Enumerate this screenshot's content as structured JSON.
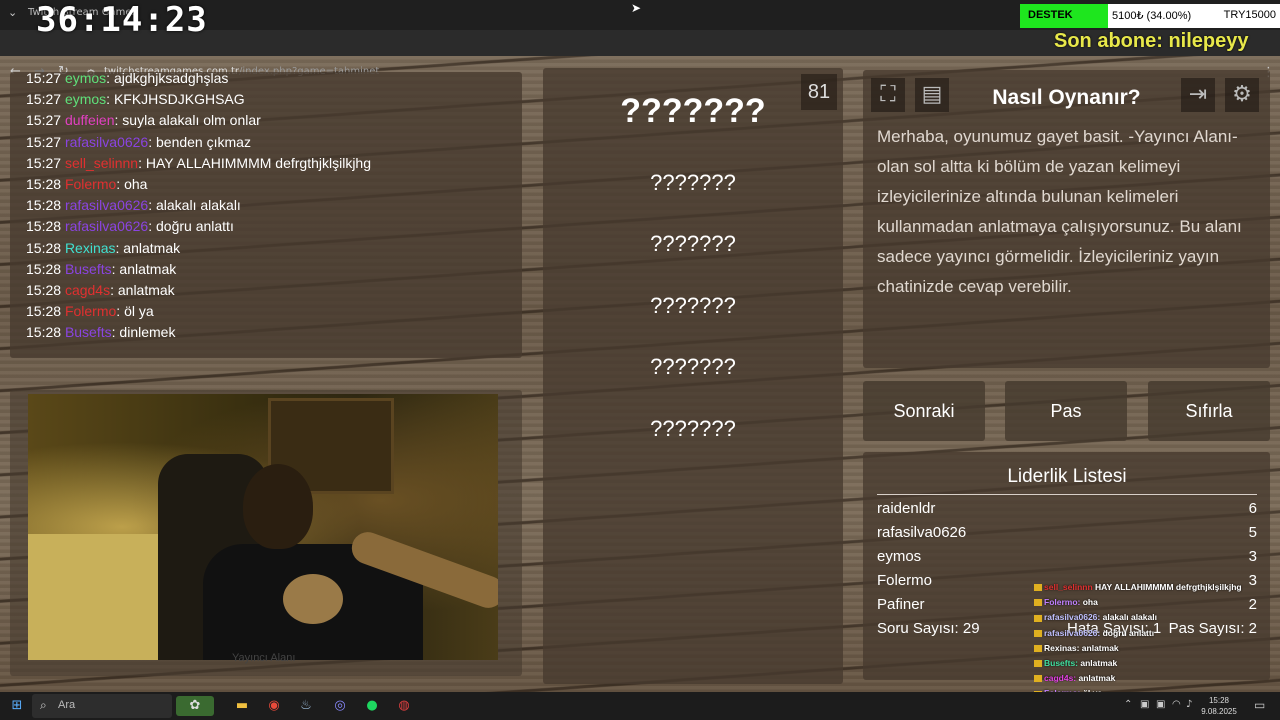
{
  "browser": {
    "tab_title": "Twitch Stream Games",
    "url_host": "twitchstreamgames.com.tr",
    "url_path": "/index.php?game=tahminet"
  },
  "timer": "36:14:23",
  "donation": {
    "label": "DESTEK",
    "value": "5100₺ (34.00%)",
    "goal": "TRY15000",
    "progress": 0.34,
    "bar_color": "#1ee61e"
  },
  "last_sub": "Son abone: nilepeyy",
  "chat": [
    {
      "time": "15:27",
      "user": "eymos",
      "color": "#5fe07a",
      "msg": ": ajdkghjksadghşlas"
    },
    {
      "time": "15:27",
      "user": "eymos",
      "color": "#5fe07a",
      "msg": ": KFKJHSDJKGHSAG"
    },
    {
      "time": "15:27",
      "user": "duffeien",
      "color": "#e040c0",
      "msg": ": suyla alakalı olm onlar"
    },
    {
      "time": "15:27",
      "user": "rafasilva0626",
      "color": "#8a44e0",
      "msg": ": benden çıkmaz"
    },
    {
      "time": "15:27",
      "user": "sell_selinnn",
      "color": "#e03030",
      "msg": ": HAY ALLAHIMMMM defrgthjklşilkjhg"
    },
    {
      "time": "15:28",
      "user": "Folermo",
      "color": "#e03030",
      "msg": ": oha"
    },
    {
      "time": "15:28",
      "user": "rafasilva0626",
      "color": "#8a44e0",
      "msg": ": alakalı alakalı"
    },
    {
      "time": "15:28",
      "user": "rafasilva0626",
      "color": "#8a44e0",
      "msg": ": doğru anlattı"
    },
    {
      "time": "15:28",
      "user": "Rexinas",
      "color": "#40e0d0",
      "msg": ": anlatmak"
    },
    {
      "time": "15:28",
      "user": "Busefts",
      "color": "#8a44e0",
      "msg": ": anlatmak"
    },
    {
      "time": "15:28",
      "user": "cagd4s",
      "color": "#e03030",
      "msg": ": anlatmak"
    },
    {
      "time": "15:28",
      "user": "Folermo",
      "color": "#e03030",
      "msg": ": öl ya"
    },
    {
      "time": "15:28",
      "user": "Busefts",
      "color": "#8a44e0",
      "msg": ": dinlemek"
    }
  ],
  "camera_label": "Yayıncı Alanı",
  "words": {
    "counter": "81",
    "main": "???????",
    "taboo": [
      "???????",
      "???????",
      "???????",
      "???????",
      "???????"
    ]
  },
  "help": {
    "title": "Nasıl Oynanır?",
    "text": "Merhaba, oyunumuz gayet basit. -Yayıncı Alanı- olan sol altta ki bölüm de yazan kelimeyi izleyicilerinize altında bulunan kelimeleri kullanmadan anlatmaya çalışıyorsunuz. Bu alanı sadece yayıncı görmelidir. İzleyicileriniz yayın chatinizde cevap verebilir."
  },
  "buttons": {
    "next": "Sonraki",
    "pass": "Pas",
    "reset": "Sıfırla"
  },
  "leaderboard": {
    "title": "Liderlik Listesi",
    "rows": [
      {
        "name": "raidenldr",
        "score": "6"
      },
      {
        "name": "rafasilva0626",
        "score": "5"
      },
      {
        "name": "eymos",
        "score": "3"
      },
      {
        "name": "Folermo",
        "score": "3"
      },
      {
        "name": "Pafiner",
        "score": "2"
      }
    ],
    "questions": "Soru Sayısı: 29",
    "errors": "Hata Sayısı: 1",
    "passes": "Pas Sayısı: 2"
  },
  "overlay_chat": [
    {
      "user": "sell_selinnn",
      "color": "#e03030",
      "msg": " HAY ALLAHIMMMM defrgthjklşilkjhg"
    },
    {
      "user": "Folermo:",
      "color": "#c080ff",
      "msg": " oha"
    },
    {
      "user": "rafasilva0626:",
      "color": "#c0c0ff",
      "msg": " alakalı alakalı"
    },
    {
      "user": "rafasilva0626:",
      "color": "#c0c0ff",
      "msg": " doğru anlattı"
    },
    {
      "user": "Rexinas:",
      "color": "#ffffff",
      "msg": " anlatmak"
    },
    {
      "user": "Busefts:",
      "color": "#40e0a0",
      "msg": " anlatmak"
    },
    {
      "user": "cagd4s:",
      "color": "#e040e0",
      "msg": " anlatmak"
    },
    {
      "user": "Folermo:",
      "color": "#c080ff",
      "msg": " öl ya"
    },
    {
      "user": "Busefts:",
      "color": "#40e0a0",
      "msg": " dinlemek"
    }
  ],
  "taskbar": {
    "search_placeholder": "Ara",
    "time": "15:28",
    "date": "9.08.2025"
  }
}
